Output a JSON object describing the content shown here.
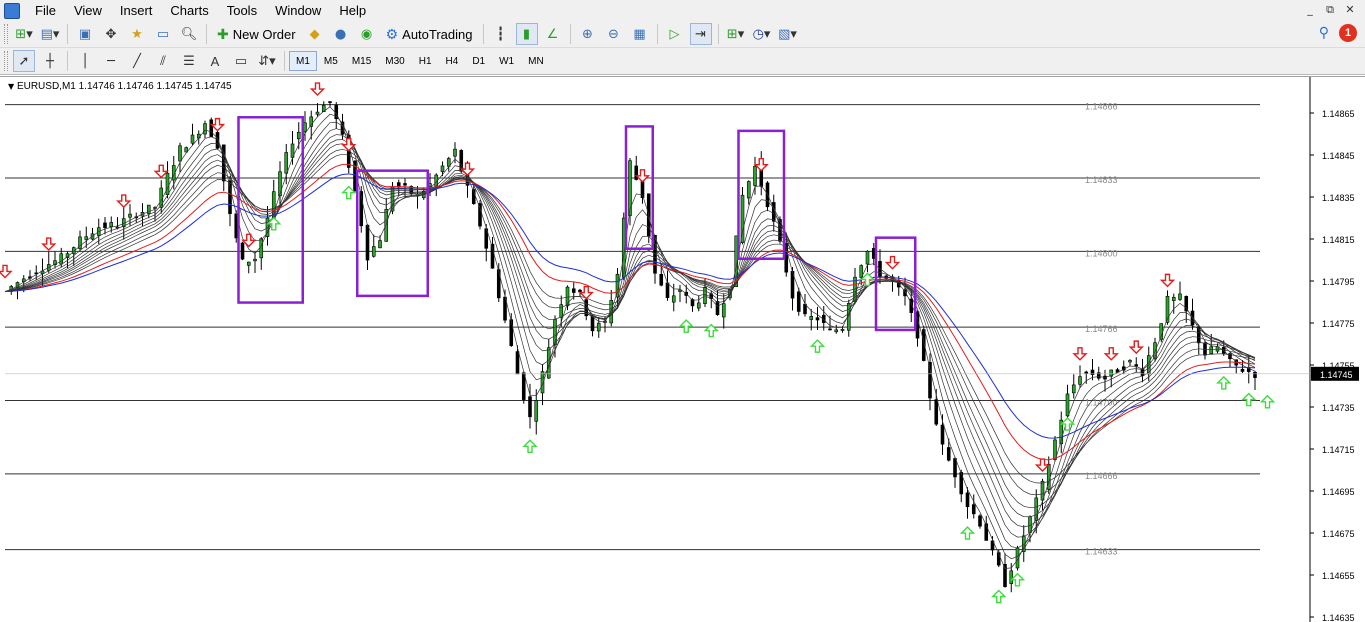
{
  "menu": [
    "File",
    "View",
    "Insert",
    "Charts",
    "Tools",
    "Window",
    "Help"
  ],
  "window_controls": [
    "_",
    "⧉",
    "✕"
  ],
  "toolbar": {
    "new_order": "New Order",
    "auto_trading": "AutoTrading",
    "timeframes": [
      "M1",
      "M5",
      "M15",
      "M30",
      "H1",
      "H4",
      "D1",
      "W1",
      "MN"
    ],
    "active_timeframe": "M1",
    "notifications": "1"
  },
  "chart": {
    "header": "EURUSD,M1  1.14746 1.14746 1.14745 1.14745",
    "current_price": "1.14745",
    "price_axis": [
      "1.14865",
      "1.14845",
      "1.14835",
      "1.14815",
      "1.14795",
      "1.14775",
      "1.14755",
      "1.14735",
      "1.14715",
      "1.14695",
      "1.14675",
      "1.14655",
      "1.14635"
    ],
    "level_labels": [
      "1.14866",
      "1.14833",
      "1.14800",
      "1.14766",
      "1.14700",
      "1.14666",
      "1.14633"
    ],
    "colors": {
      "up_arrow": "#3ddc3d",
      "down_arrow": "#e01e1e",
      "box": "#8a1fd6",
      "ma_red": "#e01e1e",
      "ma_blue": "#1f2fd6",
      "price_tag": "#000000"
    }
  },
  "chart_data": {
    "type": "candlestick",
    "symbol": "EURUSD",
    "timeframe": "M1",
    "ohlc_last": {
      "open": 1.14746,
      "high": 1.14746,
      "low": 1.14745,
      "close": 1.14745
    },
    "ylim": [
      1.14633,
      1.14873
    ],
    "horizontal_levels": [
      1.14866,
      1.14833,
      1.148,
      1.14766,
      1.14733,
      1.147,
      1.14666,
      1.14633
    ],
    "close_path": [
      [
        0,
        1.14782
      ],
      [
        3,
        1.14788
      ],
      [
        6,
        1.14793
      ],
      [
        9,
        1.14797
      ],
      [
        12,
        1.14805
      ],
      [
        15,
        1.14811
      ],
      [
        18,
        1.14812
      ],
      [
        21,
        1.14817
      ],
      [
        24,
        1.1482
      ],
      [
        26,
        1.14834
      ],
      [
        28,
        1.14846
      ],
      [
        30,
        1.14851
      ],
      [
        32,
        1.14858
      ],
      [
        34,
        1.14848
      ],
      [
        36,
        1.14816
      ],
      [
        38,
        1.14795
      ],
      [
        40,
        1.14797
      ],
      [
        42,
        1.14815
      ],
      [
        44,
        1.14835
      ],
      [
        46,
        1.1485
      ],
      [
        48,
        1.14858
      ],
      [
        50,
        1.14864
      ],
      [
        52,
        1.14867
      ],
      [
        54,
        1.14851
      ],
      [
        56,
        1.14827
      ],
      [
        58,
        1.14798
      ],
      [
        60,
        1.14806
      ],
      [
        62,
        1.1483
      ],
      [
        64,
        1.14828
      ],
      [
        66,
        1.14825
      ],
      [
        68,
        1.1483
      ],
      [
        70,
        1.14838
      ],
      [
        72,
        1.14845
      ],
      [
        74,
        1.14828
      ],
      [
        76,
        1.14812
      ],
      [
        78,
        1.14792
      ],
      [
        80,
        1.14769
      ],
      [
        82,
        1.14745
      ],
      [
        84,
        1.14725
      ],
      [
        86,
        1.14745
      ],
      [
        88,
        1.1477
      ],
      [
        90,
        1.14785
      ],
      [
        92,
        1.1478
      ],
      [
        94,
        1.14765
      ],
      [
        96,
        1.14768
      ],
      [
        98,
        1.1479
      ],
      [
        100,
        1.1484
      ],
      [
        102,
        1.14825
      ],
      [
        104,
        1.1479
      ],
      [
        106,
        1.14778
      ],
      [
        108,
        1.14783
      ],
      [
        110,
        1.14775
      ],
      [
        112,
        1.14782
      ],
      [
        114,
        1.14772
      ],
      [
        116,
        1.14785
      ],
      [
        118,
        1.14825
      ],
      [
        120,
        1.14838
      ],
      [
        122,
        1.14822
      ],
      [
        124,
        1.14803
      ],
      [
        126,
        1.1478
      ],
      [
        128,
        1.1477
      ],
      [
        130,
        1.1477
      ],
      [
        132,
        1.14764
      ],
      [
        134,
        1.14766
      ],
      [
        136,
        1.1479
      ],
      [
        138,
        1.148
      ],
      [
        140,
        1.1479
      ],
      [
        142,
        1.14786
      ],
      [
        144,
        1.14779
      ],
      [
        146,
        1.14763
      ],
      [
        148,
        1.14735
      ],
      [
        150,
        1.14712
      ],
      [
        152,
        1.147
      ],
      [
        154,
        1.14686
      ],
      [
        156,
        1.14678
      ],
      [
        158,
        1.14664
      ],
      [
        160,
        1.14651
      ],
      [
        162,
        1.14665
      ],
      [
        164,
        1.1468
      ],
      [
        166,
        1.14695
      ],
      [
        168,
        1.14715
      ],
      [
        170,
        1.14735
      ],
      [
        172,
        1.14745
      ],
      [
        174,
        1.14745
      ],
      [
        176,
        1.14743
      ],
      [
        178,
        1.14747
      ],
      [
        180,
        1.1475
      ],
      [
        182,
        1.14746
      ],
      [
        184,
        1.1476
      ],
      [
        186,
        1.14778
      ],
      [
        188,
        1.14779
      ],
      [
        190,
        1.14766
      ],
      [
        192,
        1.14754
      ],
      [
        194,
        1.14757
      ],
      [
        196,
        1.1475
      ],
      [
        198,
        1.14747
      ],
      [
        200,
        1.14745
      ]
    ],
    "signals_up_x": [
      43,
      55,
      84,
      109,
      113,
      130,
      138,
      154,
      159,
      162,
      170,
      195,
      199,
      202
    ],
    "signals_down_x": [
      0,
      7,
      19,
      25,
      34,
      39,
      50,
      55,
      74,
      93,
      102,
      121,
      142,
      166,
      172,
      177,
      181,
      186
    ],
    "highlight_boxes": [
      {
        "from_x": 38,
        "to_x": 47,
        "kind": "buy"
      },
      {
        "from_x": 57,
        "to_x": 67,
        "kind": "buy"
      },
      {
        "from_x": 100,
        "to_x": 103,
        "kind": "sell"
      },
      {
        "from_x": 118,
        "to_x": 124,
        "kind": "sell"
      },
      {
        "from_x": 140,
        "to_x": 145,
        "kind": "sell"
      }
    ]
  }
}
